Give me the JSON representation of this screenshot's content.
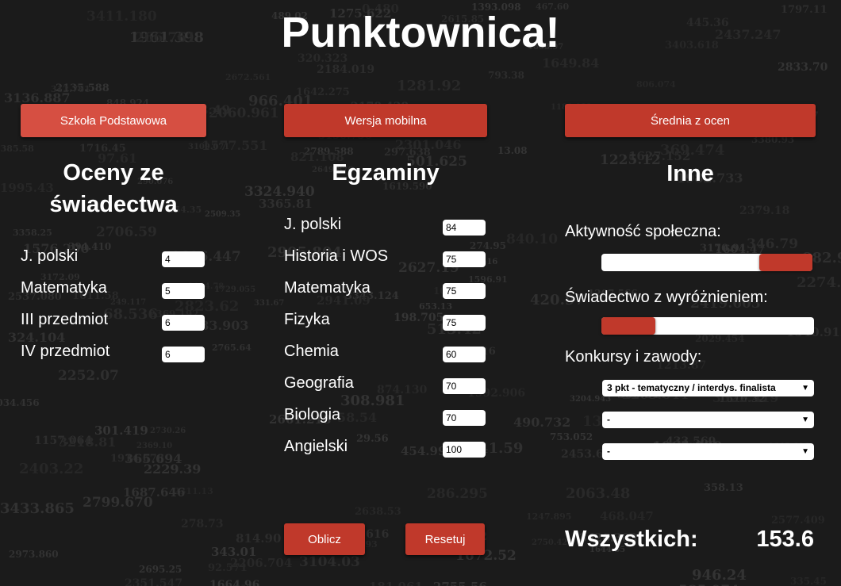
{
  "app_title": "Punktownica!",
  "buttons": {
    "primary_school": "Szkoła Podstawowa",
    "mobile_version": "Wersja mobilna",
    "grade_average": "Średnia z ocen",
    "calculate": "Oblicz",
    "reset": "Resetuj"
  },
  "grades": {
    "heading_line1": "Oceny ze",
    "heading_line2": "świadectwa",
    "items": [
      {
        "label": "J. polski",
        "value": "4"
      },
      {
        "label": "Matematyka",
        "value": "5"
      },
      {
        "label": "III przedmiot",
        "value": "6"
      },
      {
        "label": "IV przedmiot",
        "value": "6"
      }
    ]
  },
  "exams": {
    "heading": "Egzaminy",
    "items": [
      {
        "label": "J. polski",
        "value": "84"
      },
      {
        "label": "Historia i WOS",
        "value": "75"
      },
      {
        "label": "Matematyka",
        "value": "75"
      },
      {
        "label": "Fizyka",
        "value": "75"
      },
      {
        "label": "Chemia",
        "value": "60"
      },
      {
        "label": "Geografia",
        "value": "70"
      },
      {
        "label": "Biologia",
        "value": "70"
      },
      {
        "label": "Angielski",
        "value": "100"
      }
    ]
  },
  "other": {
    "heading": "Inne",
    "social_activity_label": "Aktywność społeczna:",
    "social_activity_on": true,
    "honors_label": "Świadectwo z wyróżnieniem:",
    "honors_on": false,
    "contests_label": "Konkursy i zawody:",
    "contests": [
      "3 pkt - tematyczny / interdys. finalista",
      "-",
      "-"
    ]
  },
  "total": {
    "label": "Wszystkich:",
    "value": "153.6"
  },
  "colors": {
    "accent": "#c0392b",
    "background": "#1b1b1b"
  },
  "icons": {
    "dropdown": "chevron-down-icon"
  }
}
